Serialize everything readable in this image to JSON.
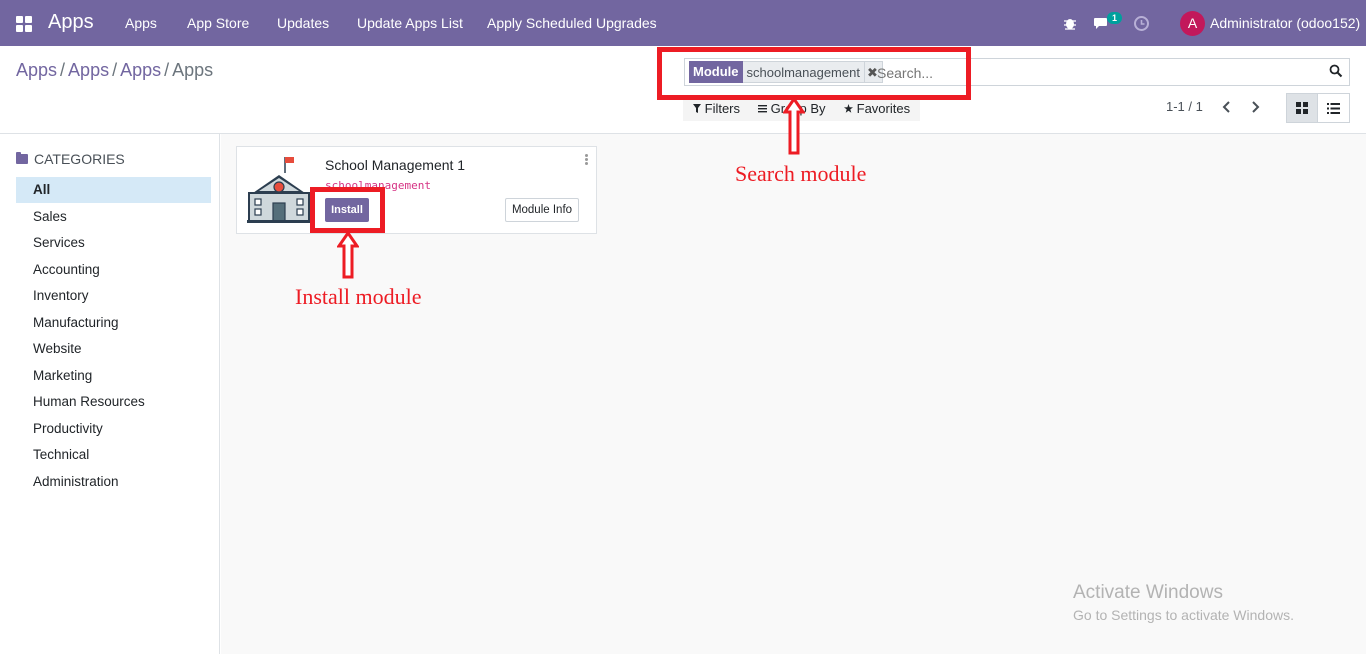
{
  "navbar": {
    "brand": "Apps",
    "menu": [
      "Apps",
      "App Store",
      "Updates",
      "Update Apps List",
      "Apply Scheduled Upgrades"
    ],
    "messages_count": "1",
    "avatar_letter": "A",
    "user": "Administrator (odoo152)",
    "bg_color": "#7266a0"
  },
  "breadcrumb": {
    "items": [
      "Apps",
      "Apps",
      "Apps"
    ],
    "current": "Apps",
    "separator": "/"
  },
  "search": {
    "facet_label": "Module",
    "facet_value": "schoolmanagement",
    "facet_close": "✖",
    "placeholder": "Search..."
  },
  "filters": {
    "filters_label": "Filters",
    "groupby_label": "Group By",
    "favorites_label": "Favorites"
  },
  "pager": {
    "value": "1-1 / 1"
  },
  "sidebar": {
    "header": "CATEGORIES",
    "items": [
      {
        "label": "All",
        "active": true
      },
      {
        "label": "Sales"
      },
      {
        "label": "Services"
      },
      {
        "label": "Accounting"
      },
      {
        "label": "Inventory"
      },
      {
        "label": "Manufacturing"
      },
      {
        "label": "Website"
      },
      {
        "label": "Marketing"
      },
      {
        "label": "Human Resources"
      },
      {
        "label": "Productivity"
      },
      {
        "label": "Technical"
      },
      {
        "label": "Administration"
      }
    ]
  },
  "module_card": {
    "title": "School Management 1",
    "technical_name": "schoolmanagement",
    "install_label": "Install",
    "info_label": "Module Info",
    "icon": "school-building-icon"
  },
  "annotations": {
    "search_label": "Search module",
    "install_label": "Install module",
    "color": "#ed1c24"
  },
  "watermark": {
    "title": "Activate Windows",
    "subtitle": "Go to Settings to activate Windows."
  }
}
